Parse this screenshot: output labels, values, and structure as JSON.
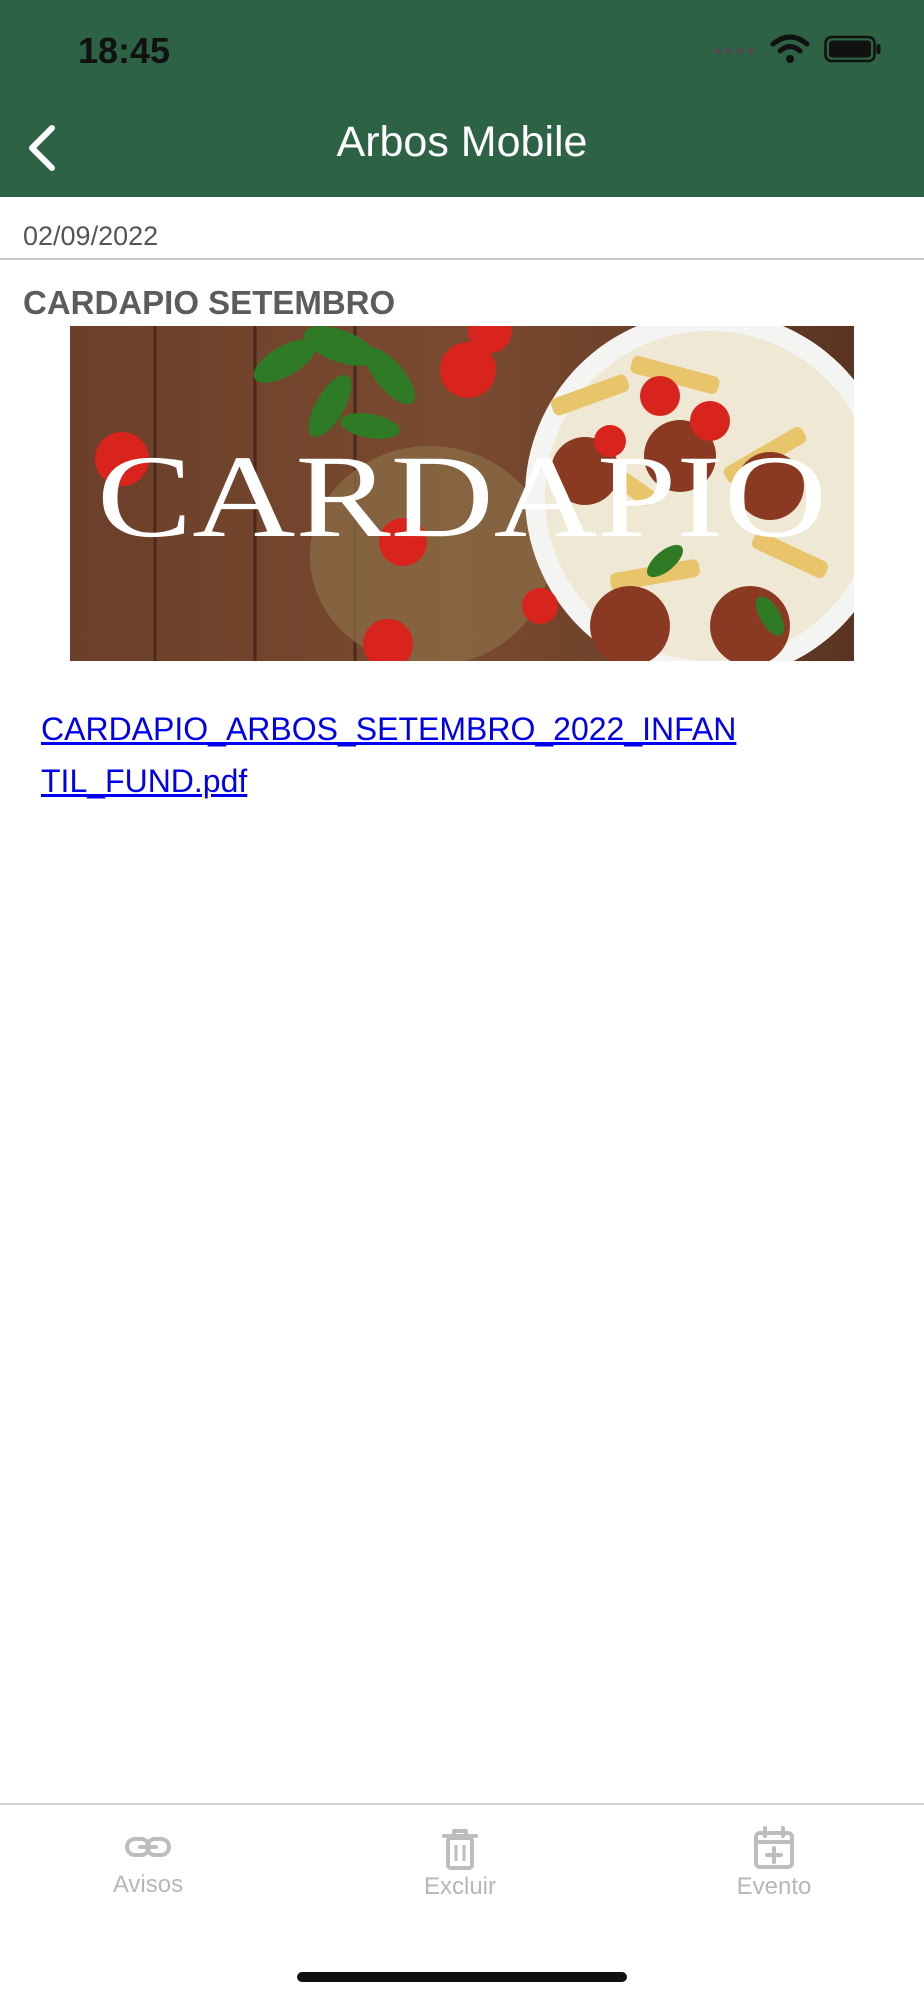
{
  "status_bar": {
    "time": "18:45"
  },
  "header": {
    "title": "Arbos Mobile",
    "back_icon": "chevron-left-icon"
  },
  "post": {
    "date": "02/09/2022",
    "title": "CARDAPIO SETEMBRO",
    "banner_text": "CARDAPIO",
    "attachment_name": "CARDAPIO_ARBOS_SETEMBRO_2022_INFANTIL_FUND.pdf"
  },
  "tabbar": {
    "items": [
      {
        "label": "Avisos",
        "icon": "link-icon"
      },
      {
        "label": "Excluir",
        "icon": "trash-icon"
      },
      {
        "label": "Evento",
        "icon": "calendar-plus-icon"
      }
    ]
  },
  "colors": {
    "header": "#2d6245",
    "link": "#0000ee",
    "tab_inactive": "#bdbdbd"
  }
}
